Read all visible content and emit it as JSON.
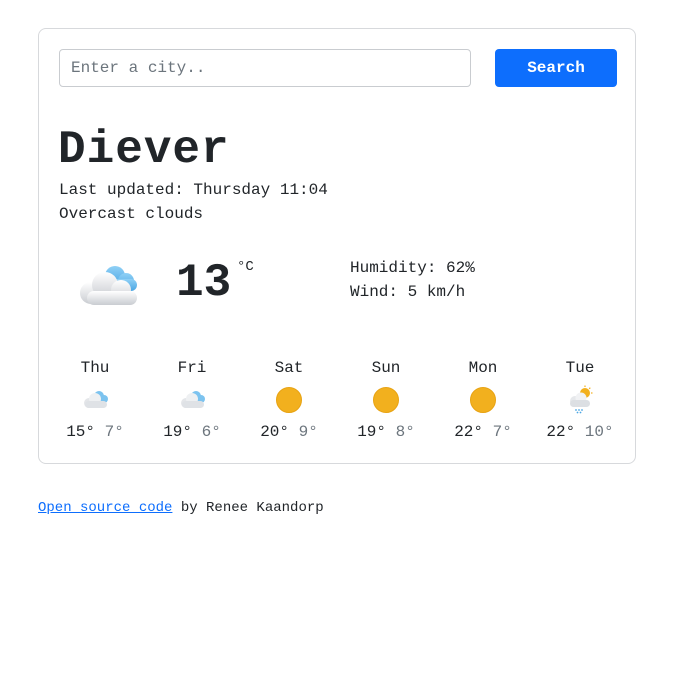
{
  "search": {
    "placeholder": "Enter a city..",
    "value": "",
    "button_label": "Search"
  },
  "weather": {
    "city": "Diever",
    "last_updated": "Last updated: Thursday 11:04",
    "description": "Overcast clouds",
    "icon": "overcast-clouds-icon",
    "temperature": "13",
    "unit": "°C",
    "humidity": "Humidity: 62%",
    "wind": "Wind: 5 km/h"
  },
  "forecast": [
    {
      "day": "Thu",
      "icon": "cloudy-icon",
      "max": "15°",
      "min": "7°"
    },
    {
      "day": "Fri",
      "icon": "cloudy-icon",
      "max": "19°",
      "min": "6°"
    },
    {
      "day": "Sat",
      "icon": "sun-icon",
      "max": "20°",
      "min": "9°"
    },
    {
      "day": "Sun",
      "icon": "sun-icon",
      "max": "19°",
      "min": "8°"
    },
    {
      "day": "Mon",
      "icon": "sun-icon",
      "max": "22°",
      "min": "7°"
    },
    {
      "day": "Tue",
      "icon": "sun-rain-cloud-icon",
      "max": "22°",
      "min": "10°"
    }
  ],
  "footer": {
    "link_text": "Open source code",
    "suffix": " by Renee Kaandorp"
  },
  "colors": {
    "accent": "#0d6efd",
    "sun": "#f2b01e",
    "muted": "#6c757d"
  }
}
